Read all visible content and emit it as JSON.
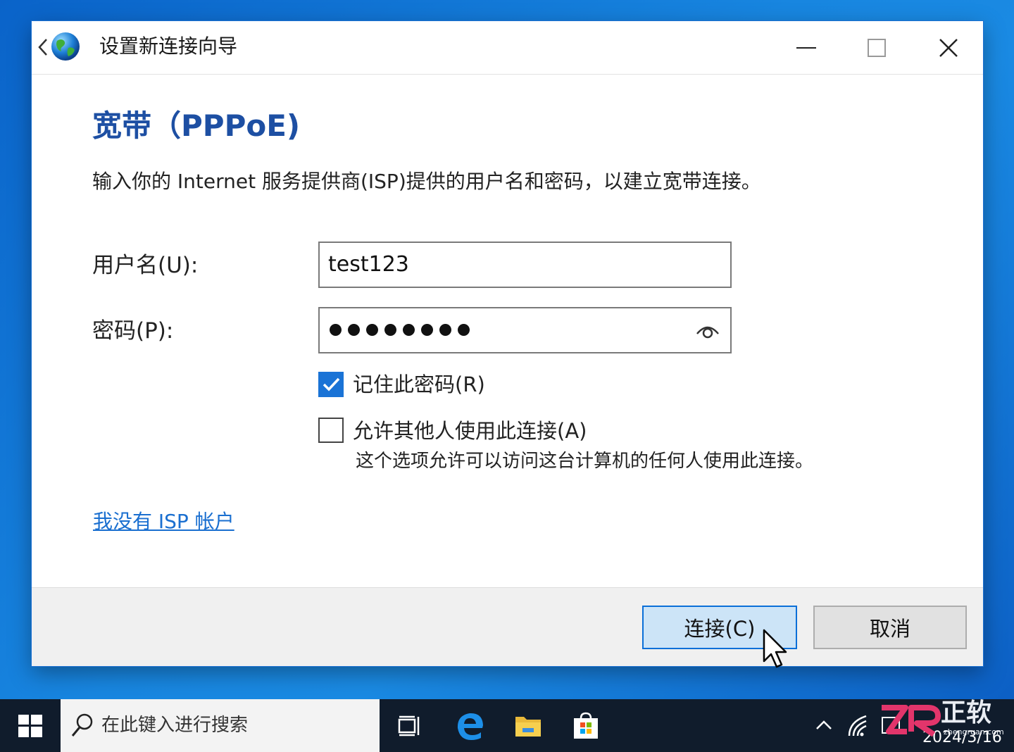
{
  "window": {
    "title": "设置新连接向导",
    "back_icon": "back-arrow-icon",
    "app_icon": "globe-icon",
    "controls": [
      "minimize-icon",
      "maximize-icon",
      "close-icon"
    ]
  },
  "content": {
    "heading": "宽带（PPPoE)",
    "description": "输入你的 Internet 服务提供商(ISP)提供的用户名和密码，以建立宽带连接。",
    "username_label": "用户名(U):",
    "username_value": "test123",
    "password_label": "密码(P):",
    "password_masked": "••••••••",
    "password_reveal_icon": "eye-icon",
    "remember_label": "记住此密码(R)",
    "remember_checked": true,
    "allow_label": "允许其他人使用此连接(A)",
    "allow_checked": false,
    "allow_note": "这个选项允许可以访问这台计算机的任何人使用此连接。",
    "no_isp_link": "我没有 ISP 帐户"
  },
  "footer": {
    "connect_label": "连接(C)",
    "cancel_label": "取消"
  },
  "taskbar": {
    "search_placeholder": "在此键入进行搜索",
    "pinned": [
      "task-view-icon",
      "edge-icon",
      "file-explorer-icon",
      "store-icon"
    ],
    "date": "2024/3/16"
  },
  "watermark": {
    "logo_text": "ZR",
    "brand": "正软",
    "url": "zhengruan.com"
  },
  "colors": {
    "accent": "#1a73d6",
    "heading": "#1d4fa3",
    "link": "#1a6fd0",
    "desktop": "#1886e0",
    "taskbar": "#101c2c"
  }
}
